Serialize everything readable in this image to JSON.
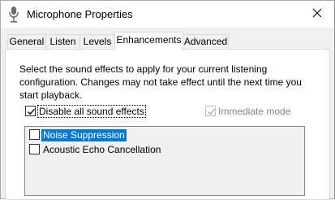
{
  "window": {
    "title": "Microphone Properties",
    "title_icon": "microphone-icon",
    "close_icon": "close-icon"
  },
  "tabs": [
    {
      "label": "General",
      "active": false
    },
    {
      "label": "Listen",
      "active": false
    },
    {
      "label": "Levels",
      "active": false
    },
    {
      "label": "Enhancements",
      "active": true
    },
    {
      "label": "Advanced",
      "active": false
    }
  ],
  "enhancements": {
    "description": "Select the sound effects to apply for your current listening configuration. Changes may not take effect until the next time you start playback.",
    "disable_all": {
      "label": "Disable all sound effects",
      "checked": true
    },
    "immediate_mode": {
      "label": "Immediate mode",
      "checked": true,
      "enabled": false
    },
    "effects": [
      {
        "label": "Noise Suppression",
        "checked": false,
        "selected": true
      },
      {
        "label": "Acoustic Echo Cancellation",
        "checked": false,
        "selected": false
      }
    ]
  },
  "colors": {
    "selection": "#0078d7",
    "disabled_text": "#838383"
  }
}
